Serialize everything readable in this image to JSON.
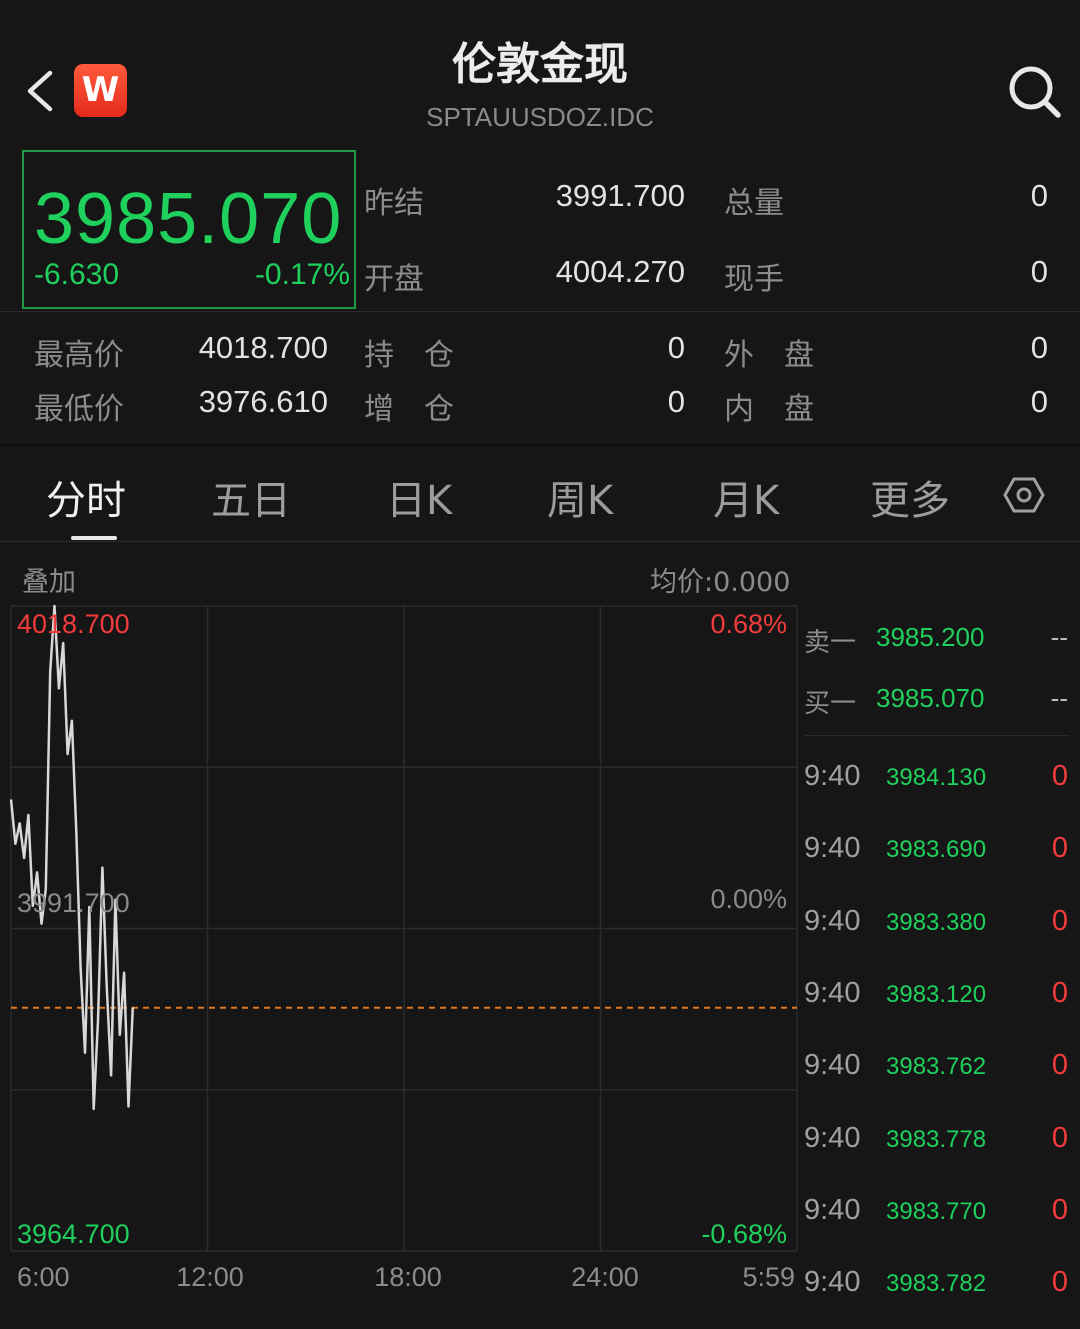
{
  "header": {
    "title": "伦敦金现",
    "subtitle": "SPTAUUSDOZ.IDC",
    "logo_letter": "W"
  },
  "quote": {
    "price": "3985.070",
    "change": "-6.630",
    "change_pct": "-0.17%"
  },
  "stats": {
    "prev_settle_label": "昨结",
    "prev_settle": "3991.700",
    "total_vol_label": "总量",
    "total_vol": "0",
    "open_label": "开盘",
    "open": "4004.270",
    "current_vol_label": "现手",
    "current_vol": "0",
    "high_label": "最高价",
    "high": "4018.700",
    "hold_label": "持　仓",
    "hold": "0",
    "outer_label": "外　盘",
    "outer": "0",
    "low_label": "最低价",
    "low": "3976.610",
    "inc_label": "增　仓",
    "inc": "0",
    "inner_label": "内　盘",
    "inner": "0"
  },
  "tabs": [
    "分时",
    "五日",
    "日K",
    "周K",
    "月K",
    "更多"
  ],
  "chart_header": {
    "overlay": "叠加",
    "avg": "均价:0.000"
  },
  "chart_data": {
    "type": "line",
    "title": "",
    "y_labels": {
      "top": "4018.700",
      "mid": "3991.700",
      "bottom": "3964.700"
    },
    "pct_labels": {
      "top": "0.68%",
      "mid": "0.00%",
      "bottom": "-0.68%"
    },
    "x_ticks": [
      "6:00",
      "12:00",
      "18:00",
      "24:00",
      "5:59"
    ],
    "ylim": [
      3964.7,
      4018.7
    ],
    "reference_price": 3985.07,
    "series": [
      {
        "values": [
          4002.5,
          3998.8,
          4000.5,
          3997.6,
          4001.2,
          3993.6,
          3996.4,
          3992.1,
          3995.0,
          4013.2,
          4018.7,
          4011.8,
          4015.6,
          4006.3,
          4009.1,
          3999.8,
          3988.4,
          3981.3,
          3993.5,
          3976.6,
          3984.0,
          3996.8,
          3986.9,
          3979.4,
          3994.1,
          3982.8,
          3988.0,
          3976.8,
          3985.1
        ]
      }
    ]
  },
  "order_book": [
    {
      "label": "卖一",
      "price": "3985.200",
      "vol": "--"
    },
    {
      "label": "买一",
      "price": "3985.070",
      "vol": "--"
    }
  ],
  "ticks": [
    {
      "time": "9:40",
      "price": "3984.130",
      "vol": "0"
    },
    {
      "time": "9:40",
      "price": "3983.690",
      "vol": "0"
    },
    {
      "time": "9:40",
      "price": "3983.380",
      "vol": "0"
    },
    {
      "time": "9:40",
      "price": "3983.120",
      "vol": "0"
    },
    {
      "time": "9:40",
      "price": "3983.762",
      "vol": "0"
    },
    {
      "time": "9:40",
      "price": "3983.778",
      "vol": "0"
    },
    {
      "time": "9:40",
      "price": "3983.770",
      "vol": "0"
    },
    {
      "time": "9:40",
      "price": "3983.782",
      "vol": "0"
    }
  ],
  "colors": {
    "up": "#f23b3b",
    "down": "#1fd05c",
    "line": "#d8d8d8",
    "ref": "#e07a22"
  }
}
